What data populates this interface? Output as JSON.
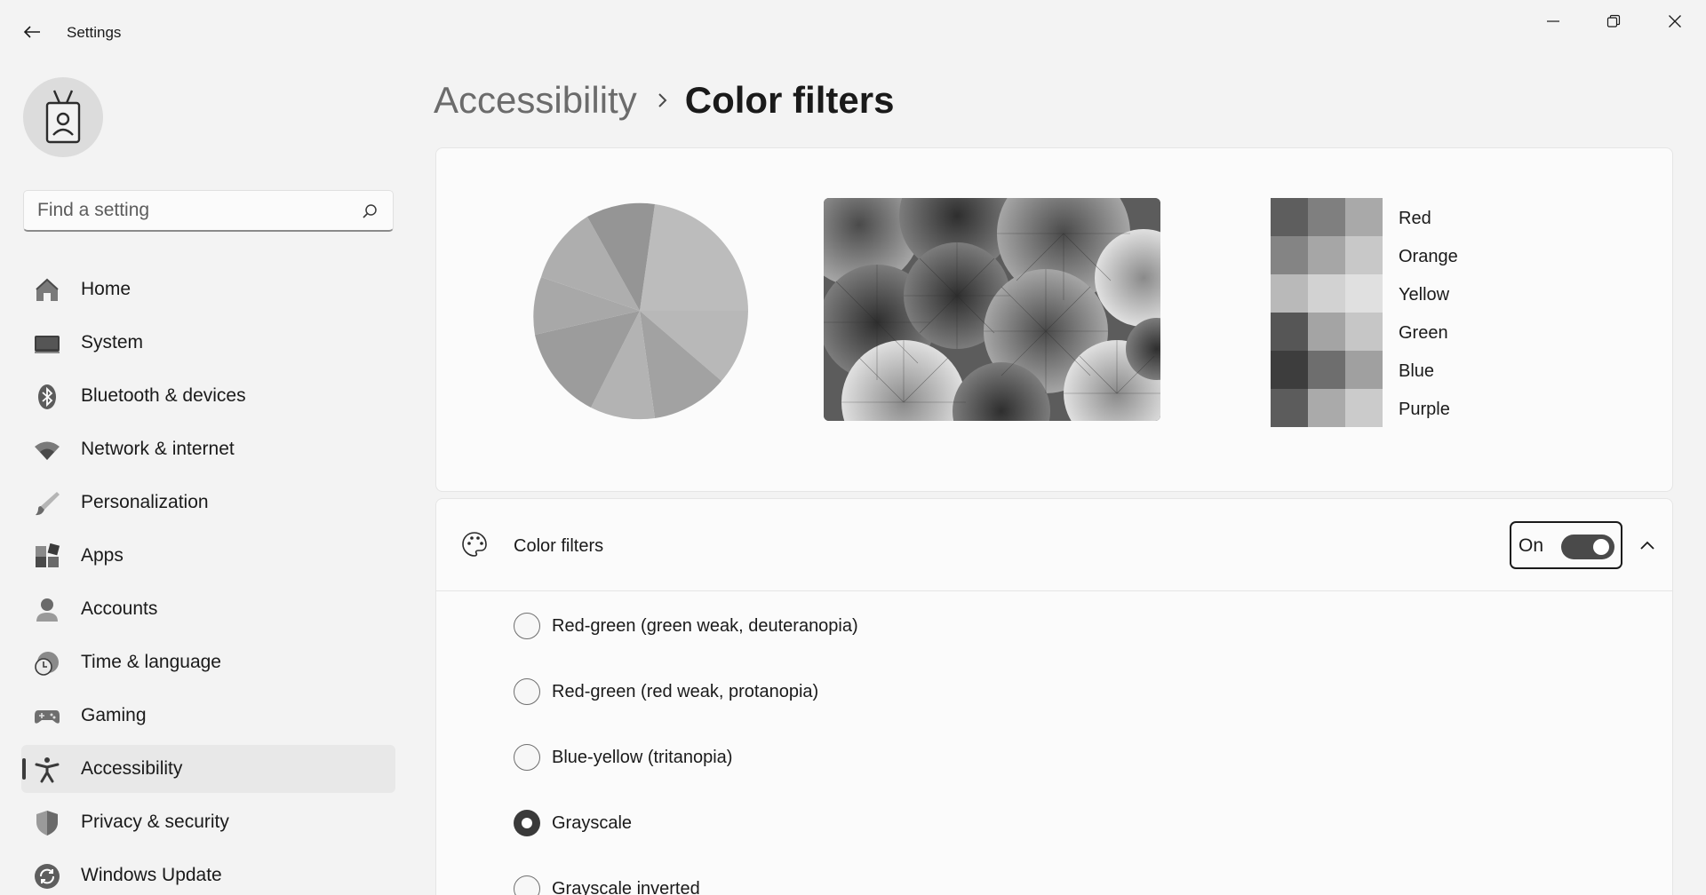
{
  "app": {
    "title": "Settings"
  },
  "search": {
    "placeholder": "Find a setting"
  },
  "sidebar": {
    "items": [
      {
        "label": "Home",
        "icon": "home-icon"
      },
      {
        "label": "System",
        "icon": "system-icon"
      },
      {
        "label": "Bluetooth & devices",
        "icon": "bluetooth-icon"
      },
      {
        "label": "Network & internet",
        "icon": "wifi-icon"
      },
      {
        "label": "Personalization",
        "icon": "brush-icon"
      },
      {
        "label": "Apps",
        "icon": "apps-icon"
      },
      {
        "label": "Accounts",
        "icon": "accounts-icon"
      },
      {
        "label": "Time & language",
        "icon": "time-language-icon"
      },
      {
        "label": "Gaming",
        "icon": "gamepad-icon"
      },
      {
        "label": "Accessibility",
        "icon": "accessibility-icon",
        "active": true
      },
      {
        "label": "Privacy & security",
        "icon": "shield-icon"
      },
      {
        "label": "Windows Update",
        "icon": "update-icon"
      }
    ]
  },
  "breadcrumb": {
    "parent": "Accessibility",
    "current": "Color filters"
  },
  "preview": {
    "swatches": [
      {
        "label": "Red",
        "shades": [
          "#5e5e5e",
          "#7f7f7f",
          "#a9a9a9"
        ]
      },
      {
        "label": "Orange",
        "shades": [
          "#848484",
          "#a6a6a6",
          "#c8c8c8"
        ]
      },
      {
        "label": "Yellow",
        "shades": [
          "#b9b9b9",
          "#d2d2d2",
          "#e0e0e0"
        ]
      },
      {
        "label": "Green",
        "shades": [
          "#565656",
          "#a4a4a4",
          "#c6c6c6"
        ]
      },
      {
        "label": "Blue",
        "shades": [
          "#3d3d3d",
          "#6e6e6e",
          "#a0a0a0"
        ]
      },
      {
        "label": "Purple",
        "shades": [
          "#5c5c5c",
          "#aaaaaa",
          "#cbcbcb"
        ]
      }
    ]
  },
  "color_filters": {
    "title": "Color filters",
    "toggle_state": "On",
    "options": [
      {
        "label": "Red-green (green weak, deuteranopia)",
        "checked": false
      },
      {
        "label": "Red-green (red weak, protanopia)",
        "checked": false
      },
      {
        "label": "Blue-yellow (tritanopia)",
        "checked": false
      },
      {
        "label": "Grayscale",
        "checked": true
      },
      {
        "label": "Grayscale inverted",
        "checked": false
      }
    ]
  }
}
